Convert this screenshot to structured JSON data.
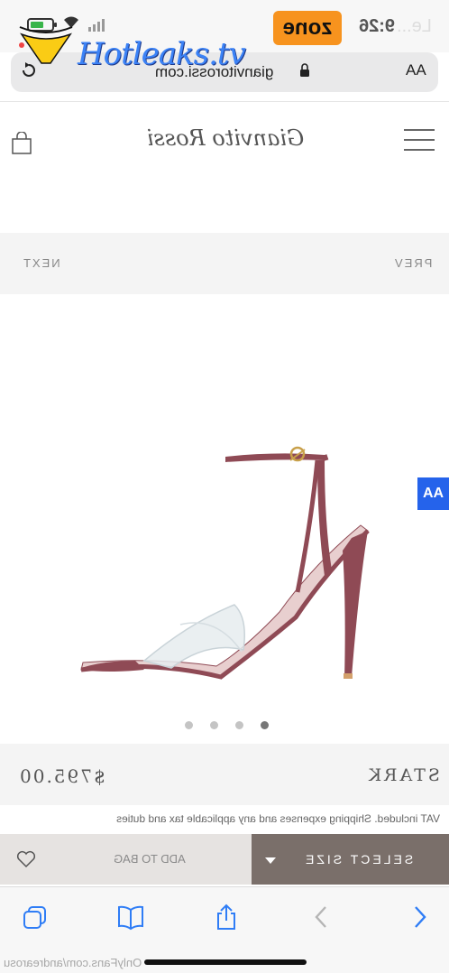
{
  "status": {
    "time": "9:26",
    "carrier": "Le...",
    "badge": "zone"
  },
  "watermark": {
    "text": "Hotleaks.tv"
  },
  "browser": {
    "url": "gianvitorossi.com",
    "text_size_label": "AA"
  },
  "header": {
    "brand": "Gianvito Rossi"
  },
  "pager": {
    "next_label": "NEXT",
    "prev_label": "PREV"
  },
  "accessibility": {
    "label": "AA"
  },
  "gallery": {
    "total": 4,
    "active_index": 3
  },
  "product": {
    "name": "STARK",
    "price": "$795.00",
    "vat_note": "VAT included. Shipping expenses and any applicable tax and duties"
  },
  "actions": {
    "add_to_bag": "ADD TO BAG",
    "select_size": "SELECT SIZE"
  },
  "footer": {
    "watermark": "OnlyFans.com/andrearosu"
  },
  "colors": {
    "accent_size_button": "#7a6f6a",
    "add_bag_bg": "#e6e3e1",
    "safari_blue": "#2f7df6",
    "shoe_leather": "#8f4a55"
  }
}
